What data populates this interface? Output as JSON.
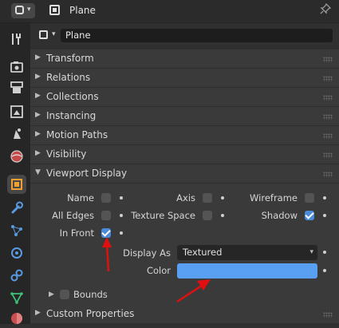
{
  "header": {
    "title": "Plane",
    "mode_icon": "editor-type-icon",
    "pin_icon": "pin-icon"
  },
  "name_row": {
    "value": "Plane"
  },
  "panels": [
    {
      "label": "Transform",
      "collapsed": true
    },
    {
      "label": "Relations",
      "collapsed": true
    },
    {
      "label": "Collections",
      "collapsed": true
    },
    {
      "label": "Instancing",
      "collapsed": true
    },
    {
      "label": "Motion Paths",
      "collapsed": true
    },
    {
      "label": "Visibility",
      "collapsed": true
    },
    {
      "label": "Viewport Display",
      "collapsed": false
    }
  ],
  "viewport_display": {
    "name": {
      "label": "Name",
      "checked": false
    },
    "axis": {
      "label": "Axis",
      "checked": false
    },
    "wireframe": {
      "label": "Wireframe",
      "checked": false
    },
    "all_edges": {
      "label": "All Edges",
      "checked": false
    },
    "texture_space": {
      "label": "Texture Space",
      "checked": false
    },
    "shadow": {
      "label": "Shadow",
      "checked": true
    },
    "in_front": {
      "label": "In Front",
      "checked": true
    },
    "display_as": {
      "label": "Display As",
      "value": "Textured"
    },
    "color": {
      "label": "Color",
      "value": "#5aa0f2"
    },
    "bounds": {
      "label": "Bounds",
      "checked": false
    }
  },
  "custom_properties": {
    "label": "Custom Properties"
  },
  "colors": {
    "accent": "#4b8ad8",
    "annotation_arrow": "#e01010"
  }
}
